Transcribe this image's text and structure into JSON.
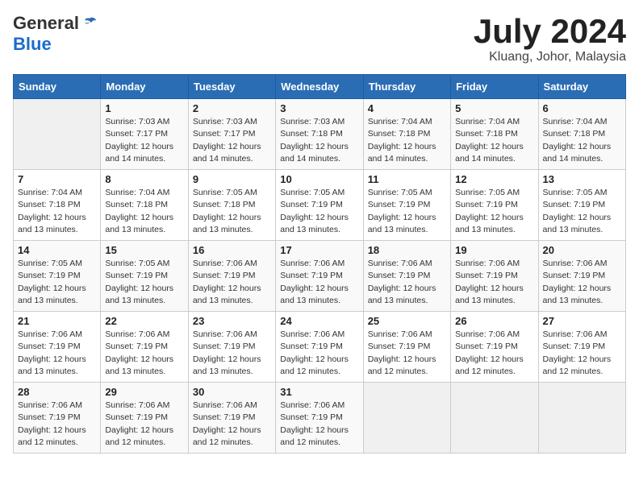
{
  "logo": {
    "general": "General",
    "blue": "Blue"
  },
  "title": "July 2024",
  "location": "Kluang, Johor, Malaysia",
  "days_of_week": [
    "Sunday",
    "Monday",
    "Tuesday",
    "Wednesday",
    "Thursday",
    "Friday",
    "Saturday"
  ],
  "weeks": [
    [
      {
        "day": "",
        "sunrise": "",
        "sunset": "",
        "daylight": ""
      },
      {
        "day": "1",
        "sunrise": "Sunrise: 7:03 AM",
        "sunset": "Sunset: 7:17 PM",
        "daylight": "Daylight: 12 hours and 14 minutes."
      },
      {
        "day": "2",
        "sunrise": "Sunrise: 7:03 AM",
        "sunset": "Sunset: 7:17 PM",
        "daylight": "Daylight: 12 hours and 14 minutes."
      },
      {
        "day": "3",
        "sunrise": "Sunrise: 7:03 AM",
        "sunset": "Sunset: 7:18 PM",
        "daylight": "Daylight: 12 hours and 14 minutes."
      },
      {
        "day": "4",
        "sunrise": "Sunrise: 7:04 AM",
        "sunset": "Sunset: 7:18 PM",
        "daylight": "Daylight: 12 hours and 14 minutes."
      },
      {
        "day": "5",
        "sunrise": "Sunrise: 7:04 AM",
        "sunset": "Sunset: 7:18 PM",
        "daylight": "Daylight: 12 hours and 14 minutes."
      },
      {
        "day": "6",
        "sunrise": "Sunrise: 7:04 AM",
        "sunset": "Sunset: 7:18 PM",
        "daylight": "Daylight: 12 hours and 14 minutes."
      }
    ],
    [
      {
        "day": "7",
        "sunrise": "Sunrise: 7:04 AM",
        "sunset": "Sunset: 7:18 PM",
        "daylight": "Daylight: 12 hours and 13 minutes."
      },
      {
        "day": "8",
        "sunrise": "Sunrise: 7:04 AM",
        "sunset": "Sunset: 7:18 PM",
        "daylight": "Daylight: 12 hours and 13 minutes."
      },
      {
        "day": "9",
        "sunrise": "Sunrise: 7:05 AM",
        "sunset": "Sunset: 7:18 PM",
        "daylight": "Daylight: 12 hours and 13 minutes."
      },
      {
        "day": "10",
        "sunrise": "Sunrise: 7:05 AM",
        "sunset": "Sunset: 7:19 PM",
        "daylight": "Daylight: 12 hours and 13 minutes."
      },
      {
        "day": "11",
        "sunrise": "Sunrise: 7:05 AM",
        "sunset": "Sunset: 7:19 PM",
        "daylight": "Daylight: 12 hours and 13 minutes."
      },
      {
        "day": "12",
        "sunrise": "Sunrise: 7:05 AM",
        "sunset": "Sunset: 7:19 PM",
        "daylight": "Daylight: 12 hours and 13 minutes."
      },
      {
        "day": "13",
        "sunrise": "Sunrise: 7:05 AM",
        "sunset": "Sunset: 7:19 PM",
        "daylight": "Daylight: 12 hours and 13 minutes."
      }
    ],
    [
      {
        "day": "14",
        "sunrise": "Sunrise: 7:05 AM",
        "sunset": "Sunset: 7:19 PM",
        "daylight": "Daylight: 12 hours and 13 minutes."
      },
      {
        "day": "15",
        "sunrise": "Sunrise: 7:05 AM",
        "sunset": "Sunset: 7:19 PM",
        "daylight": "Daylight: 12 hours and 13 minutes."
      },
      {
        "day": "16",
        "sunrise": "Sunrise: 7:06 AM",
        "sunset": "Sunset: 7:19 PM",
        "daylight": "Daylight: 12 hours and 13 minutes."
      },
      {
        "day": "17",
        "sunrise": "Sunrise: 7:06 AM",
        "sunset": "Sunset: 7:19 PM",
        "daylight": "Daylight: 12 hours and 13 minutes."
      },
      {
        "day": "18",
        "sunrise": "Sunrise: 7:06 AM",
        "sunset": "Sunset: 7:19 PM",
        "daylight": "Daylight: 12 hours and 13 minutes."
      },
      {
        "day": "19",
        "sunrise": "Sunrise: 7:06 AM",
        "sunset": "Sunset: 7:19 PM",
        "daylight": "Daylight: 12 hours and 13 minutes."
      },
      {
        "day": "20",
        "sunrise": "Sunrise: 7:06 AM",
        "sunset": "Sunset: 7:19 PM",
        "daylight": "Daylight: 12 hours and 13 minutes."
      }
    ],
    [
      {
        "day": "21",
        "sunrise": "Sunrise: 7:06 AM",
        "sunset": "Sunset: 7:19 PM",
        "daylight": "Daylight: 12 hours and 13 minutes."
      },
      {
        "day": "22",
        "sunrise": "Sunrise: 7:06 AM",
        "sunset": "Sunset: 7:19 PM",
        "daylight": "Daylight: 12 hours and 13 minutes."
      },
      {
        "day": "23",
        "sunrise": "Sunrise: 7:06 AM",
        "sunset": "Sunset: 7:19 PM",
        "daylight": "Daylight: 12 hours and 13 minutes."
      },
      {
        "day": "24",
        "sunrise": "Sunrise: 7:06 AM",
        "sunset": "Sunset: 7:19 PM",
        "daylight": "Daylight: 12 hours and 12 minutes."
      },
      {
        "day": "25",
        "sunrise": "Sunrise: 7:06 AM",
        "sunset": "Sunset: 7:19 PM",
        "daylight": "Daylight: 12 hours and 12 minutes."
      },
      {
        "day": "26",
        "sunrise": "Sunrise: 7:06 AM",
        "sunset": "Sunset: 7:19 PM",
        "daylight": "Daylight: 12 hours and 12 minutes."
      },
      {
        "day": "27",
        "sunrise": "Sunrise: 7:06 AM",
        "sunset": "Sunset: 7:19 PM",
        "daylight": "Daylight: 12 hours and 12 minutes."
      }
    ],
    [
      {
        "day": "28",
        "sunrise": "Sunrise: 7:06 AM",
        "sunset": "Sunset: 7:19 PM",
        "daylight": "Daylight: 12 hours and 12 minutes."
      },
      {
        "day": "29",
        "sunrise": "Sunrise: 7:06 AM",
        "sunset": "Sunset: 7:19 PM",
        "daylight": "Daylight: 12 hours and 12 minutes."
      },
      {
        "day": "30",
        "sunrise": "Sunrise: 7:06 AM",
        "sunset": "Sunset: 7:19 PM",
        "daylight": "Daylight: 12 hours and 12 minutes."
      },
      {
        "day": "31",
        "sunrise": "Sunrise: 7:06 AM",
        "sunset": "Sunset: 7:19 PM",
        "daylight": "Daylight: 12 hours and 12 minutes."
      },
      {
        "day": "",
        "sunrise": "",
        "sunset": "",
        "daylight": ""
      },
      {
        "day": "",
        "sunrise": "",
        "sunset": "",
        "daylight": ""
      },
      {
        "day": "",
        "sunrise": "",
        "sunset": "",
        "daylight": ""
      }
    ]
  ]
}
